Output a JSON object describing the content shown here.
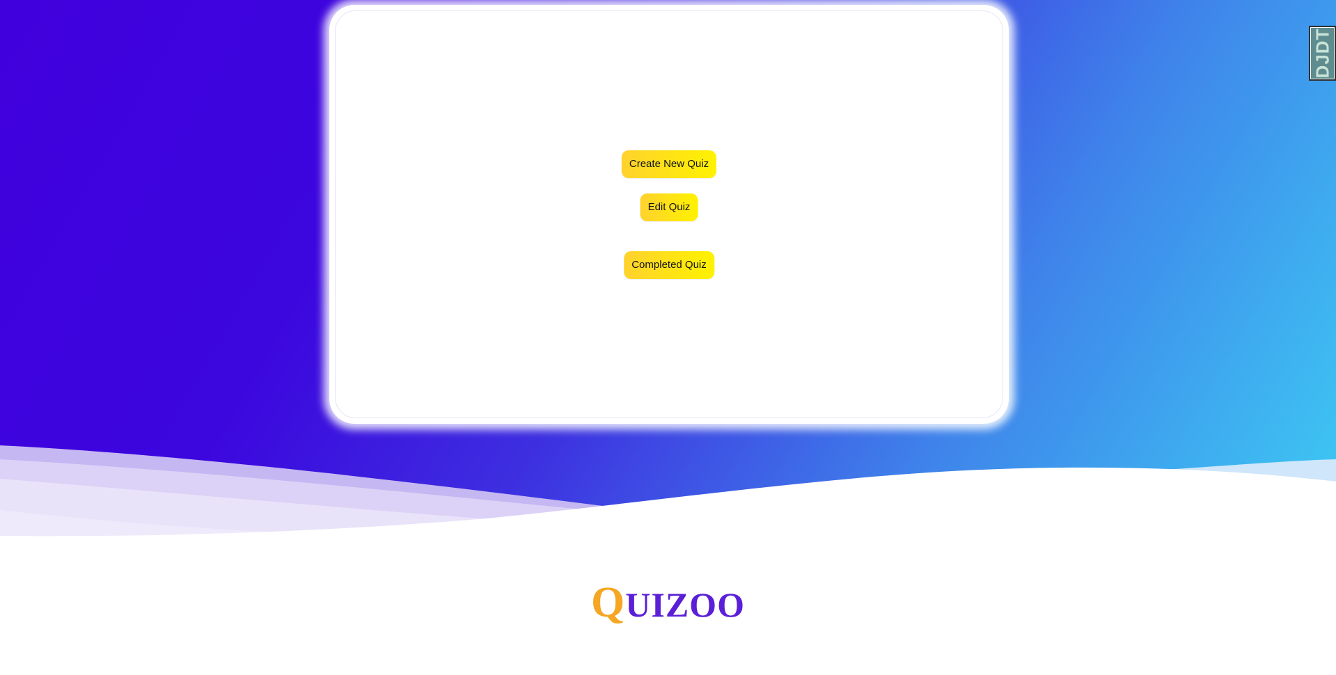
{
  "colors": {
    "gradient_start": "#4000dd",
    "gradient_end": "#3dcbf3",
    "button_gradient_start": "#ffd22e",
    "button_gradient_end": "#fff200",
    "logo_first_letter": "#f5a623",
    "logo_rest": "#5a1fd6",
    "debug_toolbar_bg": "#5f8d8f"
  },
  "menu": {
    "create_label": "Create New Quiz",
    "edit_label": "Edit Quiz",
    "completed_label": "Completed Quiz"
  },
  "debug_toolbar": {
    "label": "DJDT"
  },
  "footer": {
    "logo_first": "Q",
    "logo_rest": "UIZOO"
  }
}
